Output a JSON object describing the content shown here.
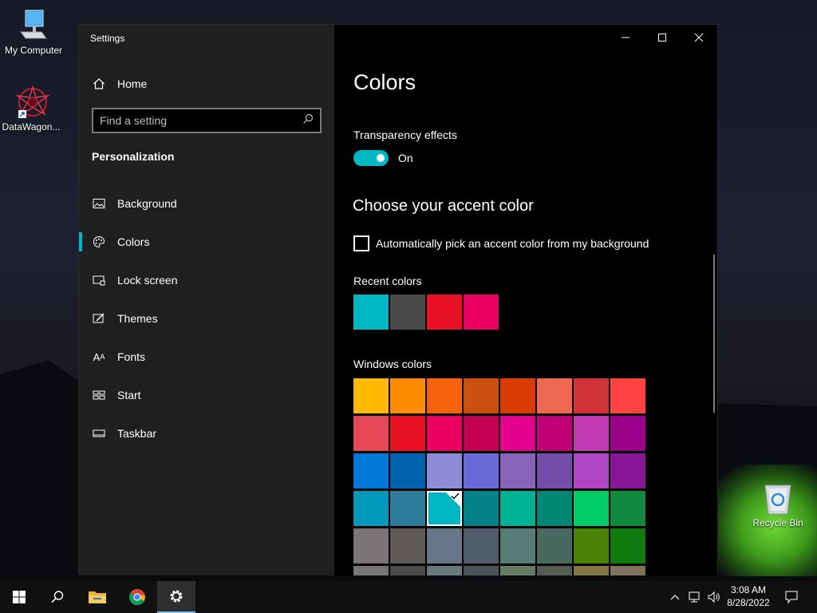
{
  "desktop": {
    "icons": [
      {
        "label": "My Computer",
        "icon": "computer-icon"
      },
      {
        "label": "DataWagon...",
        "icon": "app-shortcut-icon"
      },
      {
        "label": "Recycle Bin",
        "icon": "recycle-bin-icon"
      }
    ]
  },
  "window": {
    "title": "Settings",
    "home_label": "Home",
    "search_placeholder": "Find a setting",
    "section": "Personalization",
    "nav_items": [
      {
        "label": "Background",
        "icon": "picture-icon"
      },
      {
        "label": "Colors",
        "icon": "palette-icon",
        "active": true
      },
      {
        "label": "Lock screen",
        "icon": "lock-screen-icon"
      },
      {
        "label": "Themes",
        "icon": "themes-icon"
      },
      {
        "label": "Fonts",
        "icon": "fonts-icon"
      },
      {
        "label": "Start",
        "icon": "start-icon"
      },
      {
        "label": "Taskbar",
        "icon": "taskbar-icon"
      }
    ]
  },
  "content": {
    "page_title": "Colors",
    "transparency_label": "Transparency effects",
    "transparency_state": "On",
    "accent_heading": "Choose your accent color",
    "auto_pick_label": "Automatically pick an accent color from my background",
    "auto_pick_checked": false,
    "recent_label": "Recent colors",
    "recent_colors": [
      "#00b7c3",
      "#4c4a48",
      "#e81123",
      "#ea005e"
    ],
    "windows_label": "Windows colors",
    "windows_colors": [
      "#ffb900",
      "#ff8c00",
      "#f7630c",
      "#ca5010",
      "#da3b01",
      "#ef6950",
      "#d13438",
      "#ff4343",
      "#e74856",
      "#e81123",
      "#ea005e",
      "#c30052",
      "#e3008c",
      "#bf0077",
      "#c239b3",
      "#9a0089",
      "#0078d7",
      "#0063b1",
      "#8e8cd8",
      "#6b69d6",
      "#8764b8",
      "#744da9",
      "#b146c2",
      "#881798",
      "#0099bc",
      "#2d7d9a",
      "#00b7c3",
      "#038387",
      "#00b294",
      "#018574",
      "#00cc6a",
      "#10893e",
      "#7a7574",
      "#5d5a58",
      "#68768a",
      "#515c6b",
      "#567c73",
      "#486860",
      "#498205",
      "#107c10",
      "#767676",
      "#4c4a48",
      "#69797e",
      "#4a5459",
      "#647c64",
      "#525e54",
      "#847545",
      "#7e735f"
    ],
    "selected_color": "#00b7c3"
  },
  "colors": {
    "accent": "#00b7c3",
    "nav_bg": "#1f1f1f",
    "content_bg": "#000000"
  },
  "taskbar": {
    "time": "3:08 AM",
    "date": "8/28/2022"
  }
}
